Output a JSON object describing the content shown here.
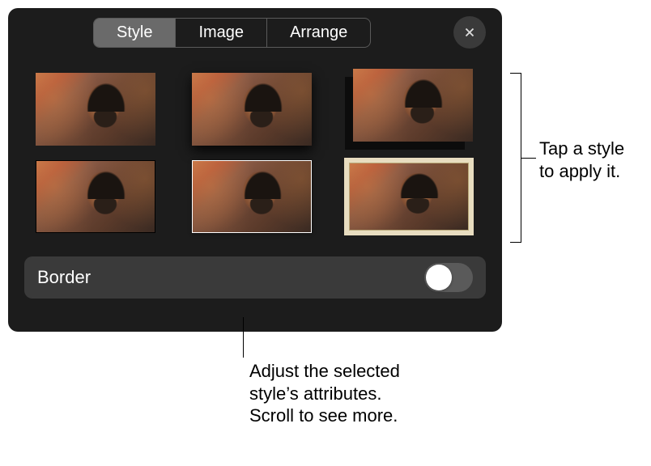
{
  "tabs": {
    "style": "Style",
    "image": "Image",
    "arrange": "Arrange",
    "active": "style"
  },
  "styles": [
    {
      "name": "none"
    },
    {
      "name": "drop-shadow"
    },
    {
      "name": "offset-shadow"
    },
    {
      "name": "thin-black-border"
    },
    {
      "name": "thin-white-border"
    },
    {
      "name": "photo-frame"
    }
  ],
  "border": {
    "label": "Border",
    "enabled": false
  },
  "callouts": {
    "styles_hint": "Tap a style\nto apply it.",
    "attributes_hint": "Adjust the selected\nstyle's attributes.\nScroll to see more."
  }
}
